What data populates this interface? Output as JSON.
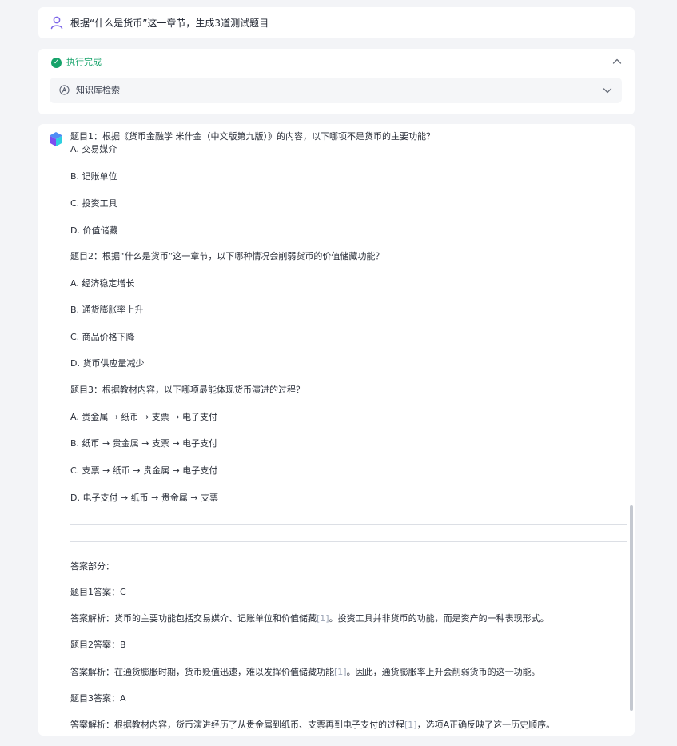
{
  "user_message": {
    "text": "根据“什么是货币”这一章节，生成3道测试题目"
  },
  "status": {
    "label": "执行完成",
    "knowledge_step": "知识库检索"
  },
  "response": {
    "questions": [
      {
        "title": "题目1：根据《货币金融学 米什金（中文版第九版）》的内容，以下哪项不是货币的主要功能？",
        "options": [
          "A. 交易媒介",
          "B. 记账单位",
          "C. 投资工具",
          "D. 价值储藏"
        ]
      },
      {
        "title": "题目2：根据“什么是货币”这一章节，以下哪种情况会削弱货币的价值储藏功能？",
        "options": [
          "A. 经济稳定增长",
          "B. 通货膨胀率上升",
          "C. 商品价格下降",
          "D. 货币供应量减少"
        ]
      },
      {
        "title": "题目3：根据教材内容，以下哪项最能体现货币演进的过程？",
        "options": [
          "A. 贵金属 → 纸币 → 支票 → 电子支付",
          "B. 纸币 → 贵金属 → 支票 → 电子支付",
          "C. 支票 → 纸币 → 贵金属 → 电子支付",
          "D. 电子支付 → 纸币 → 贵金属 → 支票"
        ]
      }
    ],
    "answer_heading": "答案部分：",
    "answers": [
      {
        "answer": "题目1答案：C",
        "explanation_pre": "答案解析：货币的主要功能包括交易媒介、记账单位和价值储藏",
        "citation": "[1]",
        "explanation_post": "。投资工具并非货币的功能，而是资产的一种表现形式。"
      },
      {
        "answer": "题目2答案：B",
        "explanation_pre": "答案解析：在通货膨胀时期，货币贬值迅速，难以发挥价值储藏功能",
        "citation": "[1]",
        "explanation_post": "。因此，通货膨胀率上升会削弱货币的这一功能。"
      },
      {
        "answer": "题目3答案：A",
        "explanation_pre": "答案解析：根据教材内容，货币演进经历了从贵金属到纸币、支票再到电子支付的过程",
        "citation": "[1]",
        "explanation_post": "，选项A正确反映了这一历史顺序。"
      }
    ]
  },
  "colors": {
    "success": "#16a36a",
    "citation": "#9aa3b5",
    "background": "#f3f4f7"
  }
}
